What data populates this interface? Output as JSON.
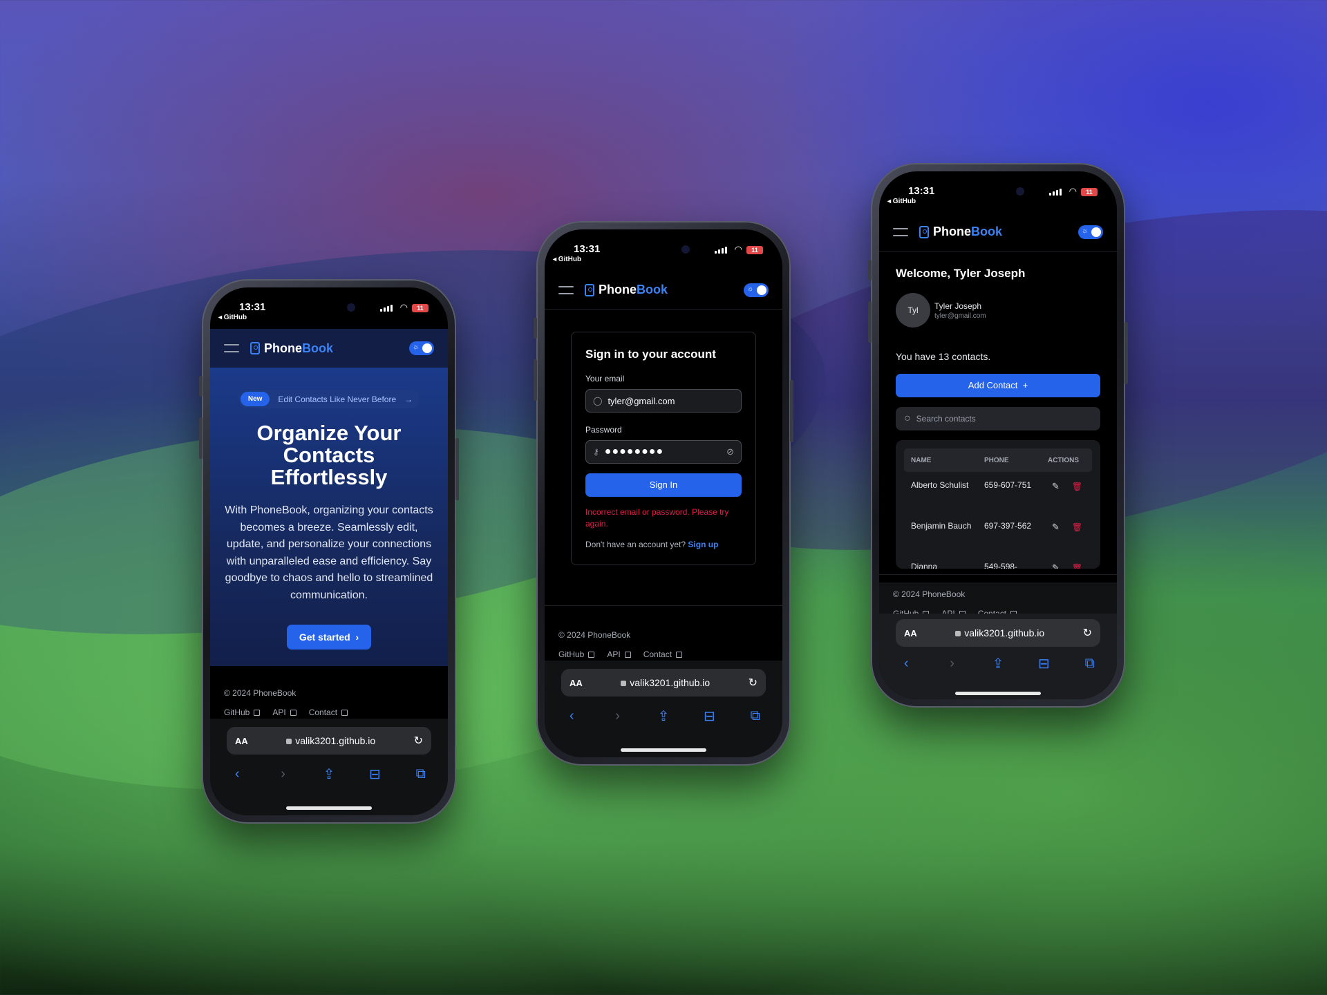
{
  "status": {
    "time": "13:31",
    "back_app": "◂ GitHub",
    "battery": "11"
  },
  "brand": {
    "name_a": "Phone",
    "name_b": "Book"
  },
  "safari": {
    "aa": "AA",
    "url": "valik3201.github.io"
  },
  "footer": {
    "copyright": "© 2024 PhoneBook",
    "link_github": "GitHub",
    "link_api": "API",
    "link_contact": "Contact"
  },
  "home": {
    "badge": "New",
    "announcement": "Edit Contacts Like Never Before",
    "title": "Organize Your Contacts Effortlessly",
    "description": "With PhoneBook, organizing your contacts becomes a breeze. Seamlessly edit, update, and personalize your connections with unparalleled ease and efficiency. Say goodbye to chaos and hello to streamlined communication.",
    "cta": "Get started"
  },
  "login": {
    "title": "Sign in to your account",
    "email_label": "Your email",
    "email_value": "tyler@gmail.com",
    "password_label": "Password",
    "password_value": "●●●●●●●●",
    "submit": "Sign In",
    "error": "Incorrect email or password. Please try again.",
    "no_account": "Don't have an account yet?",
    "signup": "Sign up"
  },
  "contacts": {
    "welcome": "Welcome, Tyler Joseph",
    "avatar": "Tyl",
    "user_name": "Tyler Joseph",
    "user_email": "tyler@gmail.com",
    "count_text": "You have 13 contacts.",
    "add_button": "Add Contact",
    "search_placeholder": "Search contacts",
    "columns": [
      "NAME",
      "PHONE",
      "ACTIONS"
    ],
    "rows": [
      {
        "name": "Alberto Schulist",
        "phone": "659-607-751"
      },
      {
        "name": "Benjamin Bauch",
        "phone": "697-397-562"
      },
      {
        "name": "Dianna",
        "phone": "549-598-"
      }
    ]
  },
  "colors": {
    "accent": "#2563eb",
    "link": "#3b82f6",
    "error": "#e11d48",
    "hero_bg": "#16295e"
  }
}
